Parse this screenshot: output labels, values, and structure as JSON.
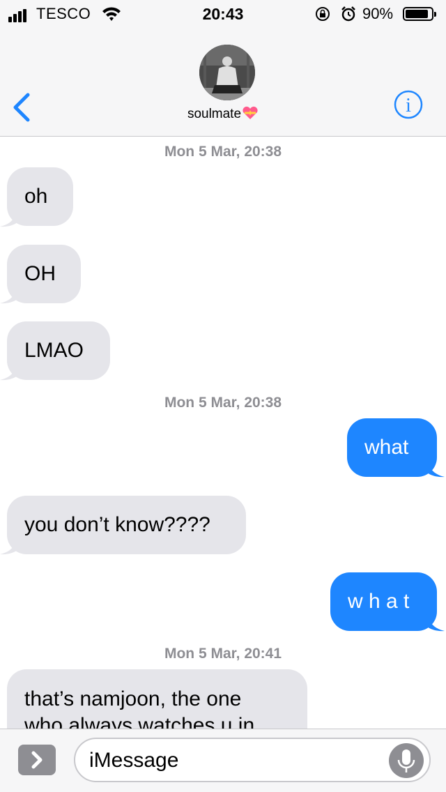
{
  "status_bar": {
    "carrier": "TESCO",
    "time": "20:43",
    "battery_percent_text": "90%",
    "battery_level": 0.9
  },
  "header": {
    "contact_name": "soulmate",
    "back_icon": "chevron-left-icon",
    "info_icon": "info-icon",
    "accent_color": "#1e86ff"
  },
  "thread": {
    "timestamps": [
      "Mon 5 Mar, 20:38",
      "Mon 5 Mar, 20:38",
      "Mon 5 Mar, 20:41"
    ],
    "messages": [
      {
        "from": "them",
        "text": "oh"
      },
      {
        "from": "them",
        "text": "OH"
      },
      {
        "from": "them",
        "text": "LMAO"
      },
      {
        "from": "me",
        "text": "what"
      },
      {
        "from": "them",
        "text": "you don’t know????"
      },
      {
        "from": "me",
        "text": "w h a t"
      },
      {
        "from": "them",
        "text": "that’s namjoon, the one"
      },
      {
        "from": "them",
        "text": "who always watches u in"
      }
    ],
    "incoming_color": "#e5e5ea",
    "outgoing_color": "#1e86ff"
  },
  "input_bar": {
    "placeholder": "iMessage",
    "apps_icon": "chevron-right-icon",
    "mic_icon": "microphone-icon"
  }
}
